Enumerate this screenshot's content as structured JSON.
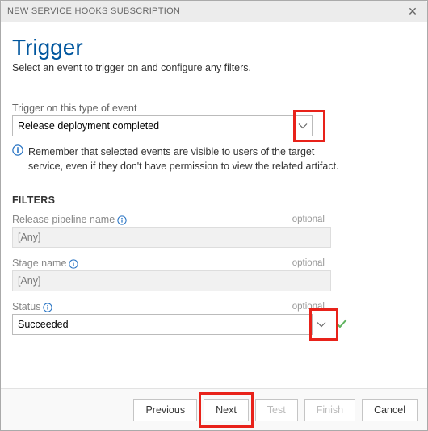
{
  "titlebar": {
    "title": "NEW SERVICE HOOKS SUBSCRIPTION"
  },
  "header": {
    "title": "Trigger",
    "subtitle": "Select an event to trigger on and configure any filters."
  },
  "event": {
    "label": "Trigger on this type of event",
    "selected": "Release deployment completed"
  },
  "info_text": "Remember that selected events are visible to users of the target service, even if they don't have permission to view the related artifact.",
  "filters_heading": "FILTERS",
  "filters": {
    "pipeline": {
      "label": "Release pipeline name",
      "optional": "optional",
      "value": "[Any]"
    },
    "stage": {
      "label": "Stage name",
      "optional": "optional",
      "value": "[Any]"
    },
    "status": {
      "label": "Status",
      "optional": "optional",
      "value": "Succeeded"
    }
  },
  "footer": {
    "previous": "Previous",
    "next": "Next",
    "test": "Test",
    "finish": "Finish",
    "cancel": "Cancel"
  },
  "colors": {
    "highlight": "#e8221a",
    "accent": "#00569e"
  }
}
